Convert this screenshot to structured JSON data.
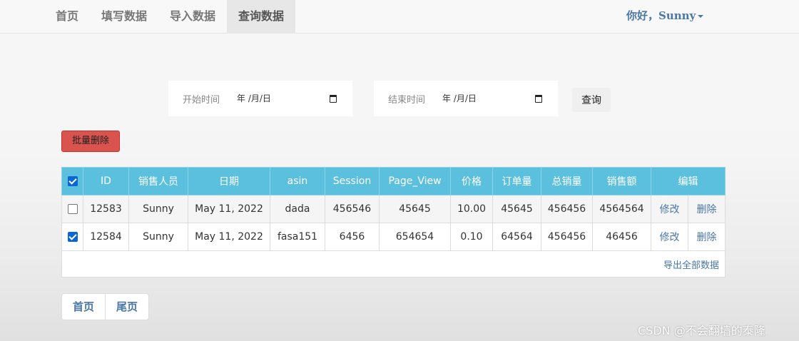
{
  "nav": {
    "items": [
      {
        "label": "首页",
        "active": false
      },
      {
        "label": "填写数据",
        "active": false
      },
      {
        "label": "导入数据",
        "active": false
      },
      {
        "label": "查询数据",
        "active": true
      }
    ],
    "user_greeting": "你好，Sunny"
  },
  "filters": {
    "start_label": "开始时间",
    "start_value": "年 /月/日",
    "end_label": "结束时间",
    "end_value": "年 /月/日",
    "query_label": "查询"
  },
  "actions": {
    "batch_delete_label": "批量删除"
  },
  "table": {
    "header_checked": true,
    "columns": [
      "ID",
      "销售人员",
      "日期",
      "asin",
      "Session",
      "Page_View",
      "价格",
      "订单量",
      "总销量",
      "销售额",
      "编辑"
    ],
    "rows": [
      {
        "checked": false,
        "id": "12583",
        "seller": "Sunny",
        "date": "May 11, 2022",
        "asin": "dada",
        "session": "456546",
        "page_view": "45645",
        "price": "10.00",
        "orders": "45645",
        "total_sales": "456456",
        "revenue": "4564564",
        "edit_label": "修改",
        "delete_label": "删除"
      },
      {
        "checked": true,
        "id": "12584",
        "seller": "Sunny",
        "date": "May 11, 2022",
        "asin": "fasa151",
        "session": "6456",
        "page_view": "654654",
        "price": "0.10",
        "orders": "64564",
        "total_sales": "456456",
        "revenue": "46456",
        "edit_label": "修改",
        "delete_label": "删除"
      }
    ],
    "export_label": "导出全部数据"
  },
  "pagination": {
    "first_label": "首页",
    "last_label": "尾页"
  },
  "watermark": "CSDN @不会翻墙的泰隆",
  "colors": {
    "header_bg": "#5bc0de",
    "danger": "#d9534f",
    "link": "#4a77a8",
    "checkbox": "#0a66d6"
  }
}
